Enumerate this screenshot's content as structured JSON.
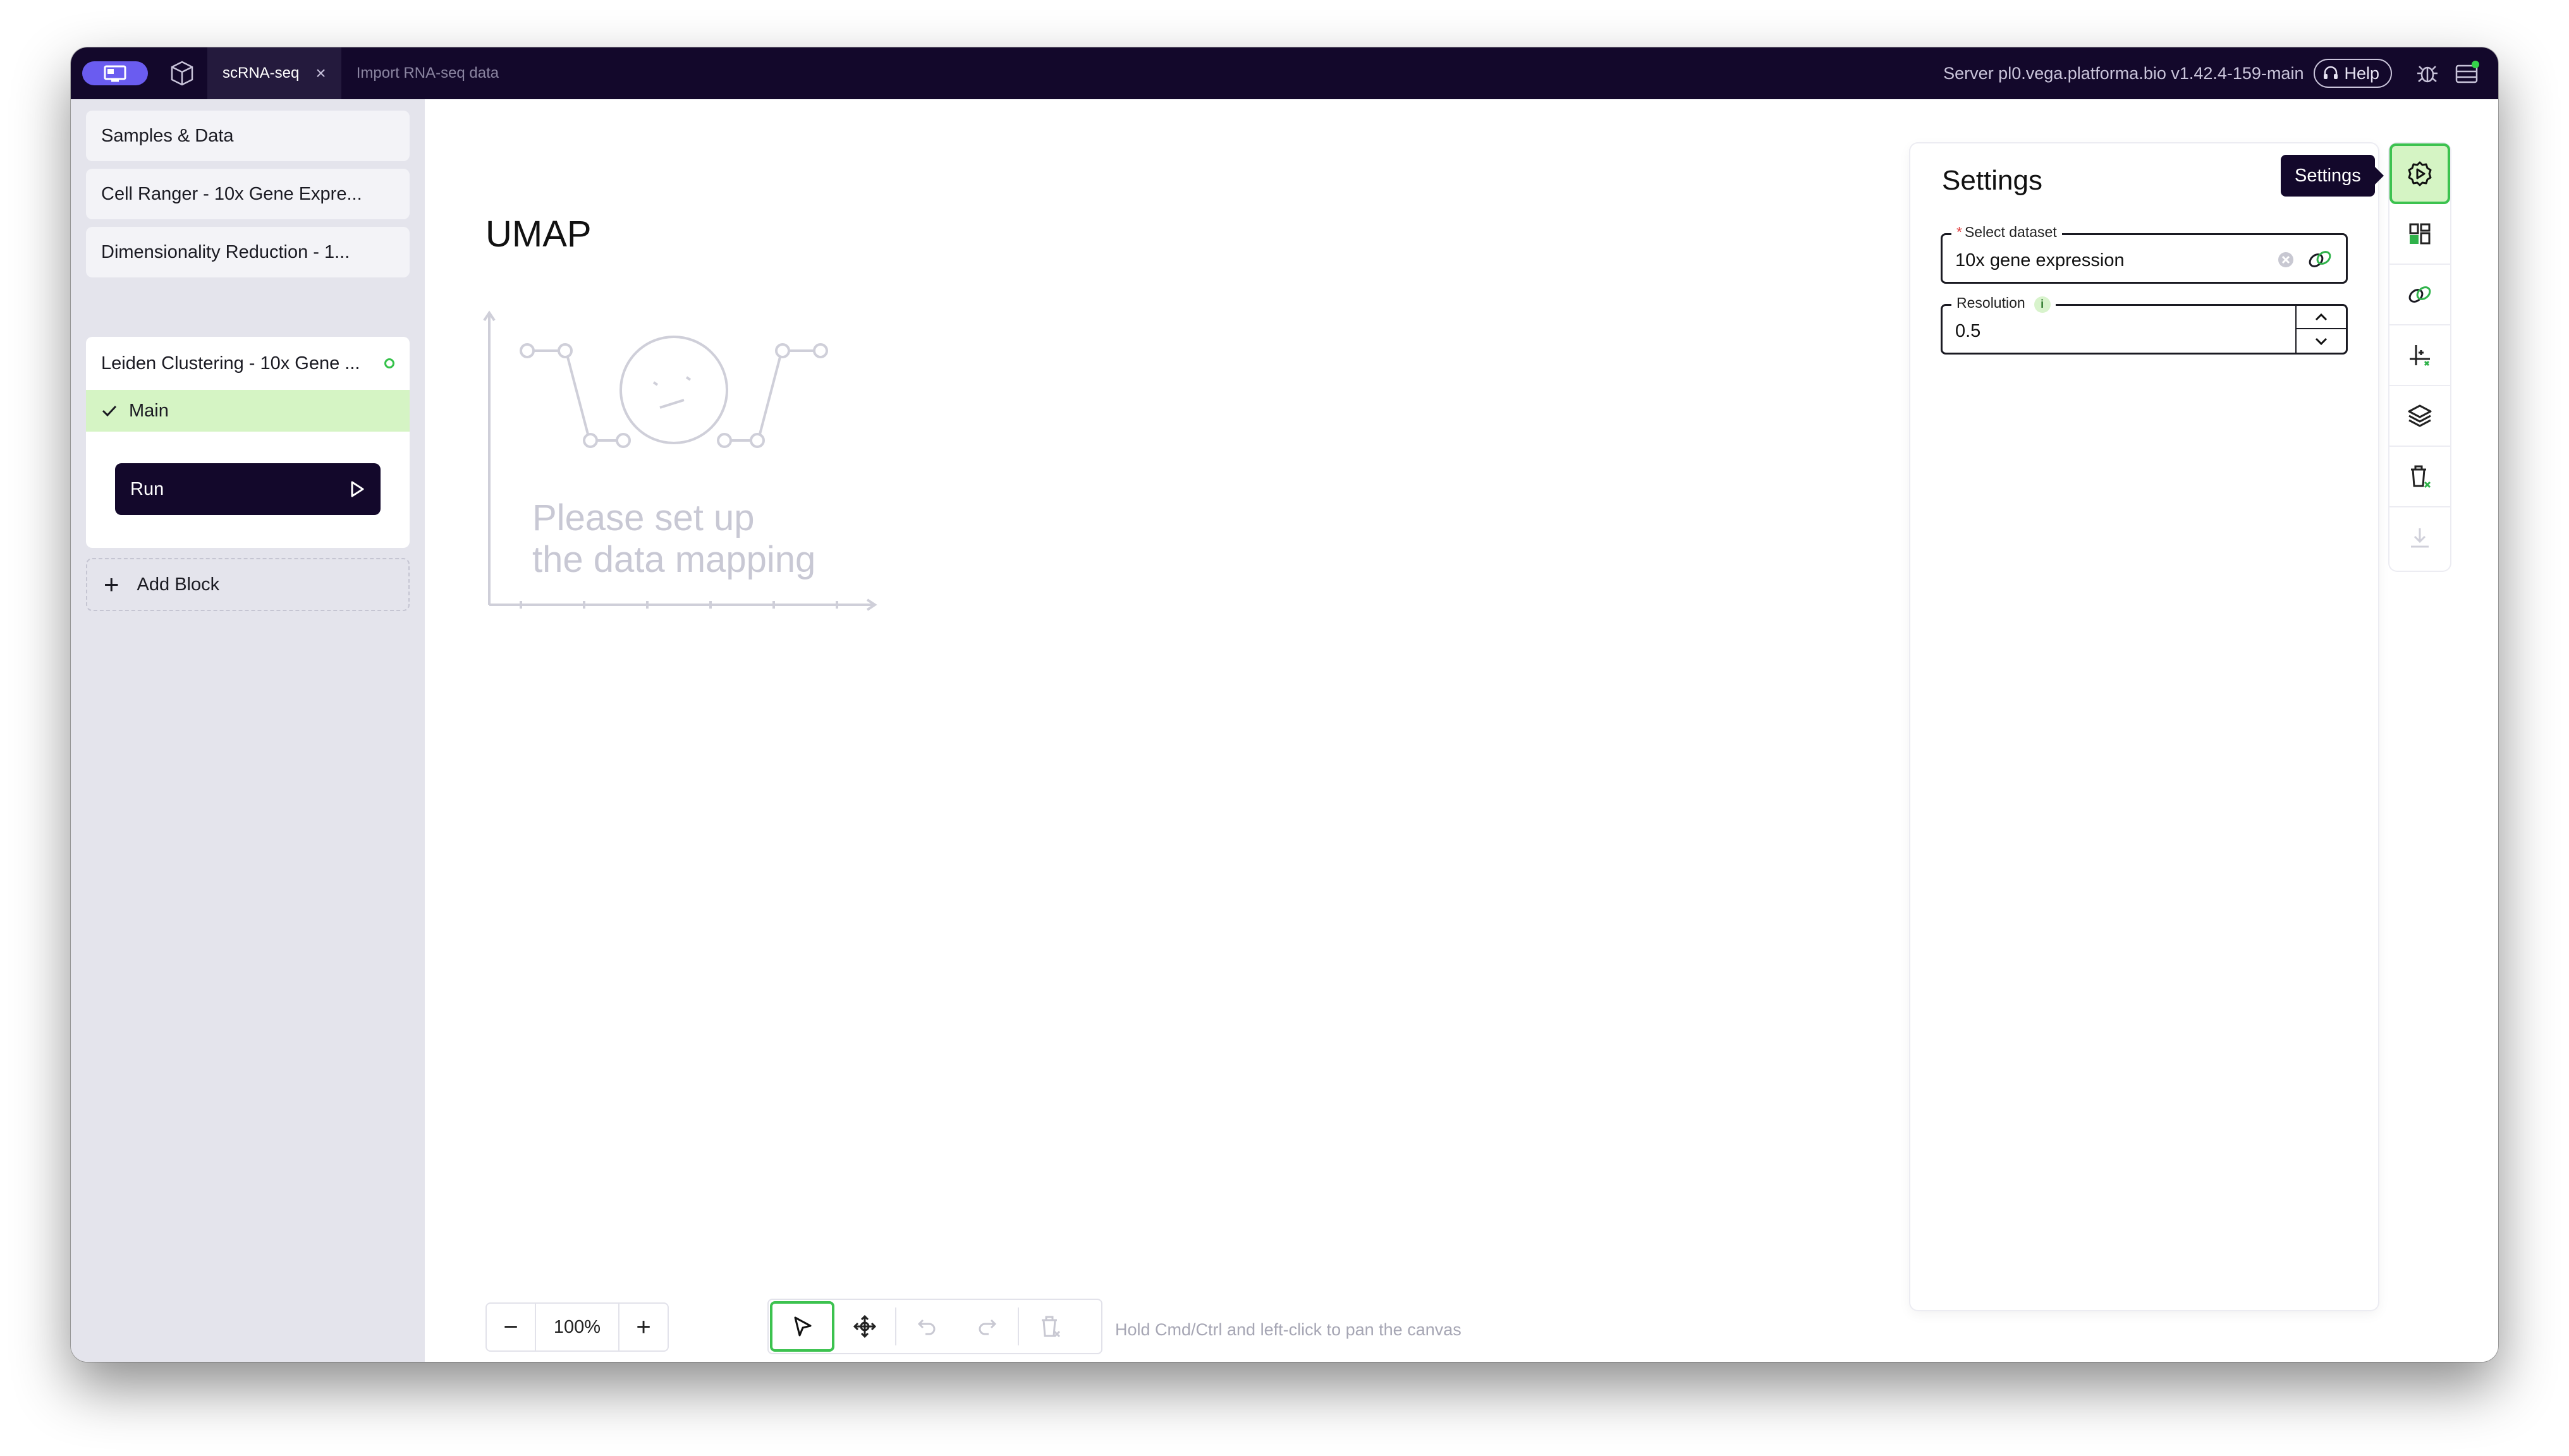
{
  "titlebar": {
    "tabs": [
      {
        "label": "scRNA-seq",
        "active": true,
        "close": "×"
      },
      {
        "label": "Import RNA-seq data",
        "active": false
      }
    ],
    "server_text": "Server pl0.vega.platforma.bio v1.42.4-159-main",
    "help_label": "Help"
  },
  "sidebar": {
    "blocks": [
      {
        "label": "Samples & Data"
      },
      {
        "label": "Cell Ranger - 10x Gene Expre..."
      },
      {
        "label": "Dimensionality Reduction - 1..."
      }
    ],
    "expanded_block": {
      "label": "Leiden Clustering - 10x Gene ...",
      "section": "Main",
      "run_label": "Run"
    },
    "add_block_label": "Add Block"
  },
  "canvas": {
    "title": "UMAP",
    "placeholder": "Please set up\nthe data mapping",
    "zoom": "100%",
    "zoom_out": "−",
    "zoom_in": "+",
    "hint": "Hold Cmd/Ctrl and left-click to pan the canvas"
  },
  "settings": {
    "title": "Settings",
    "dataset_label": "Select dataset",
    "dataset_required": "*",
    "dataset_value": "10x gene expression",
    "resolution_label": "Resolution",
    "resolution_info": "i",
    "resolution_value": "0.5"
  },
  "tooltip": "Settings",
  "colors": {
    "titlebar_bg": "#13082b",
    "accent_green": "#3cc24f",
    "accent_green_light": "#d5f4c4",
    "brand_purple": "#6a5cf0"
  }
}
